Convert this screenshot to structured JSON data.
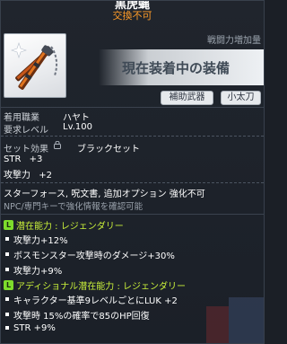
{
  "item": {
    "name": "黒虎蝿",
    "trade_status": "交換不可",
    "icon": "paired-rod-weapon-icon"
  },
  "power": {
    "label": "戦闘力増加量",
    "banner": "現在装着中の装備"
  },
  "tags": [
    "補助武器",
    "小太刀"
  ],
  "requirements": {
    "job_label": "着用職業",
    "job_value": "ハヤト",
    "level_label": "要求レベル",
    "level_value": "Lv.100"
  },
  "set": {
    "label": "セット効果",
    "name": "ブラックセット"
  },
  "stats": [
    {
      "name": "STR",
      "value": "+3"
    },
    {
      "name": "攻撃力",
      "value": "+2"
    }
  ],
  "note": "スターフォース, 呪文書, 追加オプション 強化不可",
  "hint": "NPC/専門キーで強化情報を確認可能",
  "potential": {
    "badge": "L",
    "title": "潜在能力 : レジェンダリー",
    "lines": [
      "攻撃力+12%",
      "ボスモンスター攻撃時のダメージ+30%",
      "攻撃力+9%"
    ]
  },
  "additional_potential": {
    "badge": "L",
    "title": "アディショナル潜在能力 : レジェンダリー",
    "lines": [
      "キャラクター基準9レベルごとにLUK +2",
      "攻撃時 15%の確率で85のHP回復",
      "STR +9%"
    ]
  },
  "colors": {
    "trade_status": "#ff9c28",
    "potential_title": "#c9f03a",
    "badge": "#7ddc2c"
  }
}
